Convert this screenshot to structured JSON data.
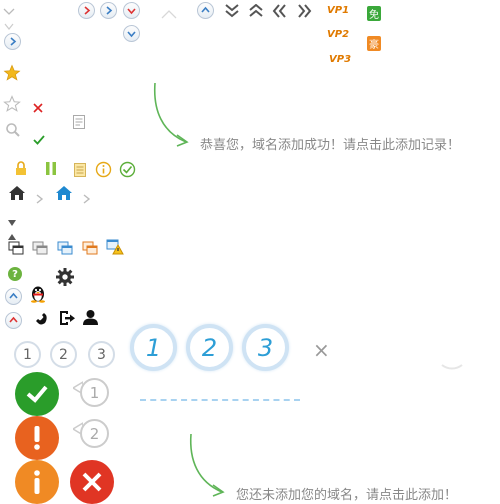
{
  "vip_labels": [
    "VP1",
    "VP2",
    "VP3"
  ],
  "tags": {
    "free": "免",
    "luxury": "豪"
  },
  "messages": {
    "success": "恭喜您，域名添加成功！请点击此添加记录！",
    "not_added": "您还未添加您的域名，请点击此添加！"
  },
  "small_numbers": [
    "1",
    "2",
    "3"
  ],
  "large_numbers": [
    "1",
    "2",
    "3"
  ],
  "bubble_numbers": [
    "1",
    "2"
  ],
  "close_symbol": "×",
  "colors": {
    "accent_blue": "#2d9ed6",
    "success_green": "#2a9d2a",
    "warning_orange": "#e8621f",
    "danger_red": "#e03524",
    "vip_orange": "#e07a00"
  }
}
